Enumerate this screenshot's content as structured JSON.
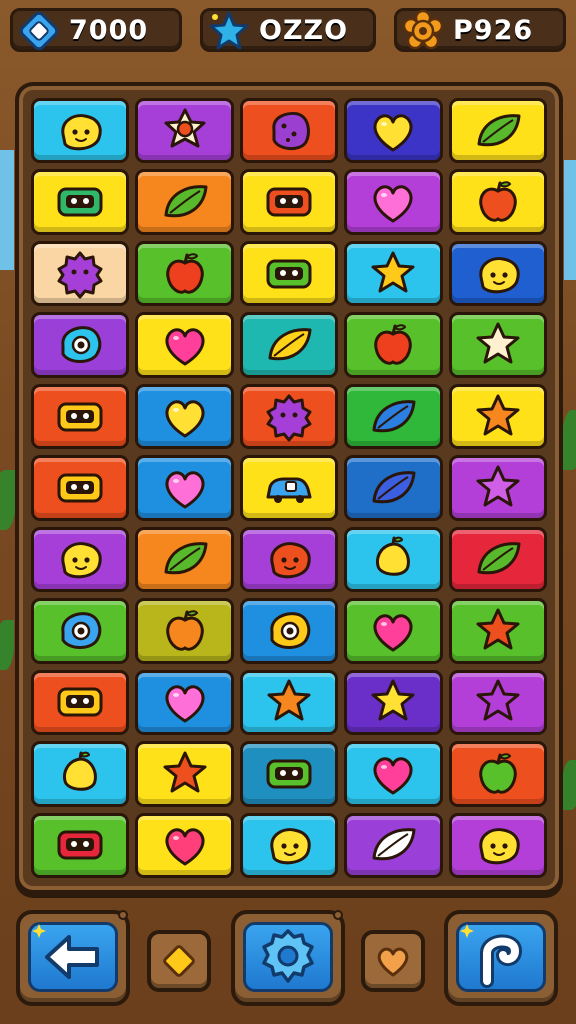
{
  "hud": {
    "left": {
      "value": "7000",
      "icon": "diamond-icon",
      "icon_color": "#3aa4ef"
    },
    "middle": {
      "value": "OZZO",
      "icon": "star-icon",
      "icon_color": "#2fb2e8"
    },
    "right": {
      "value": "P926",
      "icon": "gear-flower-icon",
      "icon_color": "#f29a1c"
    }
  },
  "board": {
    "rows": 11,
    "cols": 5,
    "tiles": [
      [
        {
          "bg": "#2cc4ec",
          "icon": "blob",
          "color": "#ffe033"
        },
        {
          "bg": "#a63fd8",
          "icon": "flower",
          "color": "#fff1d0"
        },
        {
          "bg": "#ee4f1e",
          "icon": "cookie",
          "color": "#9a3fd0"
        },
        {
          "bg": "#3b34c6",
          "icon": "heart",
          "color": "#ffe033"
        },
        {
          "bg": "#ffe11a",
          "icon": "leaf",
          "color": "#57b92b"
        }
      ],
      [
        {
          "bg": "#ffe11a",
          "icon": "robot",
          "color": "#2fb86a"
        },
        {
          "bg": "#f5871e",
          "icon": "leaf",
          "color": "#57b92b"
        },
        {
          "bg": "#ffe11a",
          "icon": "robot",
          "color": "#ee4f1e"
        },
        {
          "bg": "#b33fd8",
          "icon": "heart",
          "color": "#ff6fd8"
        },
        {
          "bg": "#ffe11a",
          "icon": "apple",
          "color": "#ee4f1e"
        }
      ],
      [
        {
          "bg": "#fad6a5",
          "icon": "gear",
          "color": "#a63fd8"
        },
        {
          "bg": "#57c02b",
          "icon": "apple",
          "color": "#ee3f1e"
        },
        {
          "bg": "#ffe11a",
          "icon": "robot",
          "color": "#57c02b"
        },
        {
          "bg": "#2cc4ec",
          "icon": "star",
          "color": "#ffc91a"
        },
        {
          "bg": "#1f5fd0",
          "icon": "blob",
          "color": "#ffe033"
        }
      ],
      [
        {
          "bg": "#9a3fd8",
          "icon": "ring",
          "color": "#2cc4ec"
        },
        {
          "bg": "#ffe11a",
          "icon": "heart",
          "color": "#ff3f9a"
        },
        {
          "bg": "#1fb8b0",
          "icon": "leaf",
          "color": "#ffd31a"
        },
        {
          "bg": "#57c02b",
          "icon": "apple",
          "color": "#ee3f1e"
        },
        {
          "bg": "#57c02b",
          "icon": "star",
          "color": "#fff1d0"
        }
      ],
      [
        {
          "bg": "#ee4f1e",
          "icon": "robot",
          "color": "#ffc91a"
        },
        {
          "bg": "#1f8fe0",
          "icon": "heart",
          "color": "#ffe033"
        },
        {
          "bg": "#ee4f1e",
          "icon": "gear",
          "color": "#a63fd8"
        },
        {
          "bg": "#2fb83a",
          "icon": "leaf",
          "color": "#2a7fe0"
        },
        {
          "bg": "#ffe11a",
          "icon": "star",
          "color": "#f5871e"
        }
      ],
      [
        {
          "bg": "#ee4f1e",
          "icon": "robot",
          "color": "#ffc91a"
        },
        {
          "bg": "#1f8fe0",
          "icon": "heart",
          "color": "#ff6fd8"
        },
        {
          "bg": "#ffe11a",
          "icon": "car",
          "color": "#3aa4ef"
        },
        {
          "bg": "#1f6fc8",
          "icon": "leaf",
          "color": "#3b5fe0"
        },
        {
          "bg": "#b33fd8",
          "icon": "star",
          "color": "#d05fe8"
        }
      ],
      [
        {
          "bg": "#a63fd8",
          "icon": "blob",
          "color": "#ffe033"
        },
        {
          "bg": "#f5871e",
          "icon": "leaf",
          "color": "#57b92b"
        },
        {
          "bg": "#a63fd8",
          "icon": "blob",
          "color": "#ee4f1e"
        },
        {
          "bg": "#2cc4ec",
          "icon": "lemon",
          "color": "#ffe033"
        },
        {
          "bg": "#e6263a",
          "icon": "leaf",
          "color": "#57b92b"
        }
      ],
      [
        {
          "bg": "#57c02b",
          "icon": "ring",
          "color": "#3aa4ef"
        },
        {
          "bg": "#b8b61a",
          "icon": "apple",
          "color": "#f5871e"
        },
        {
          "bg": "#1f8fe0",
          "icon": "ring",
          "color": "#ffc91a"
        },
        {
          "bg": "#57c02b",
          "icon": "heart",
          "color": "#ff3f9a"
        },
        {
          "bg": "#57c02b",
          "icon": "star",
          "color": "#ee4f1e"
        }
      ],
      [
        {
          "bg": "#ee4f1e",
          "icon": "robot",
          "color": "#ffc91a"
        },
        {
          "bg": "#1f8fe0",
          "icon": "heart",
          "color": "#ff6fd8"
        },
        {
          "bg": "#2cc4ec",
          "icon": "star",
          "color": "#f5871e"
        },
        {
          "bg": "#6a2fc8",
          "icon": "star",
          "color": "#ffe033"
        },
        {
          "bg": "#b33fd8",
          "icon": "star",
          "color": "#b33fd8"
        }
      ],
      [
        {
          "bg": "#2cc4ec",
          "icon": "lemon",
          "color": "#ffe033"
        },
        {
          "bg": "#ffe11a",
          "icon": "star",
          "color": "#ee4f1e"
        },
        {
          "bg": "#1f8fc0",
          "icon": "robot",
          "color": "#57c02b"
        },
        {
          "bg": "#2cc4ec",
          "icon": "heart",
          "color": "#ff3f9a"
        },
        {
          "bg": "#ee4f1e",
          "icon": "apple",
          "color": "#57c02b"
        }
      ],
      [
        {
          "bg": "#57c02b",
          "icon": "robot",
          "color": "#e6263a"
        },
        {
          "bg": "#ffe11a",
          "icon": "heart",
          "color": "#ff3f7a"
        },
        {
          "bg": "#2cc4ec",
          "icon": "blob",
          "color": "#ffe033"
        },
        {
          "bg": "#9a3fd8",
          "icon": "leaf",
          "color": "#ffffff"
        },
        {
          "bg": "#b33fd8",
          "icon": "blob",
          "color": "#ffe033"
        }
      ]
    ]
  },
  "controls": {
    "back": {
      "icon": "arrow-left-icon"
    },
    "diamond": {
      "icon": "diamond-icon"
    },
    "settings": {
      "icon": "gear-icon"
    },
    "heart": {
      "icon": "heart-icon"
    },
    "hook": {
      "icon": "hook-icon"
    }
  }
}
